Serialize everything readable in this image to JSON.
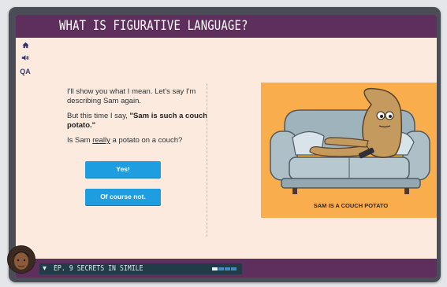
{
  "title": "WHAT IS FIGURATIVE LANGUAGE?",
  "side_nav": {
    "home_icon": "home-icon",
    "audio_icon": "speaker-icon",
    "qa_label": "QA"
  },
  "lesson": {
    "para1": "I'll show you what I mean. Let's say I'm describing Sam again.",
    "para2_prefix": "But this time I say, ",
    "para2_quote": "\"Sam is such a couch potato.\"",
    "para3_pre": "Is Sam ",
    "para3_underlined": "really",
    "para3_post": " a potato on a couch?"
  },
  "answers": {
    "yes": "Yes!",
    "no": "Of course not."
  },
  "illustration": {
    "caption": "SAM IS A COUCH POTATO",
    "background_color": "#f9ad4c"
  },
  "footer": {
    "episode": "EP. 9 SECRETS IN SIMILE",
    "progress_segments": 4,
    "progress_active": 1
  },
  "colors": {
    "titlebar": "#5e2f5c",
    "button": "#1e9de0",
    "background": "#fbeadd"
  }
}
